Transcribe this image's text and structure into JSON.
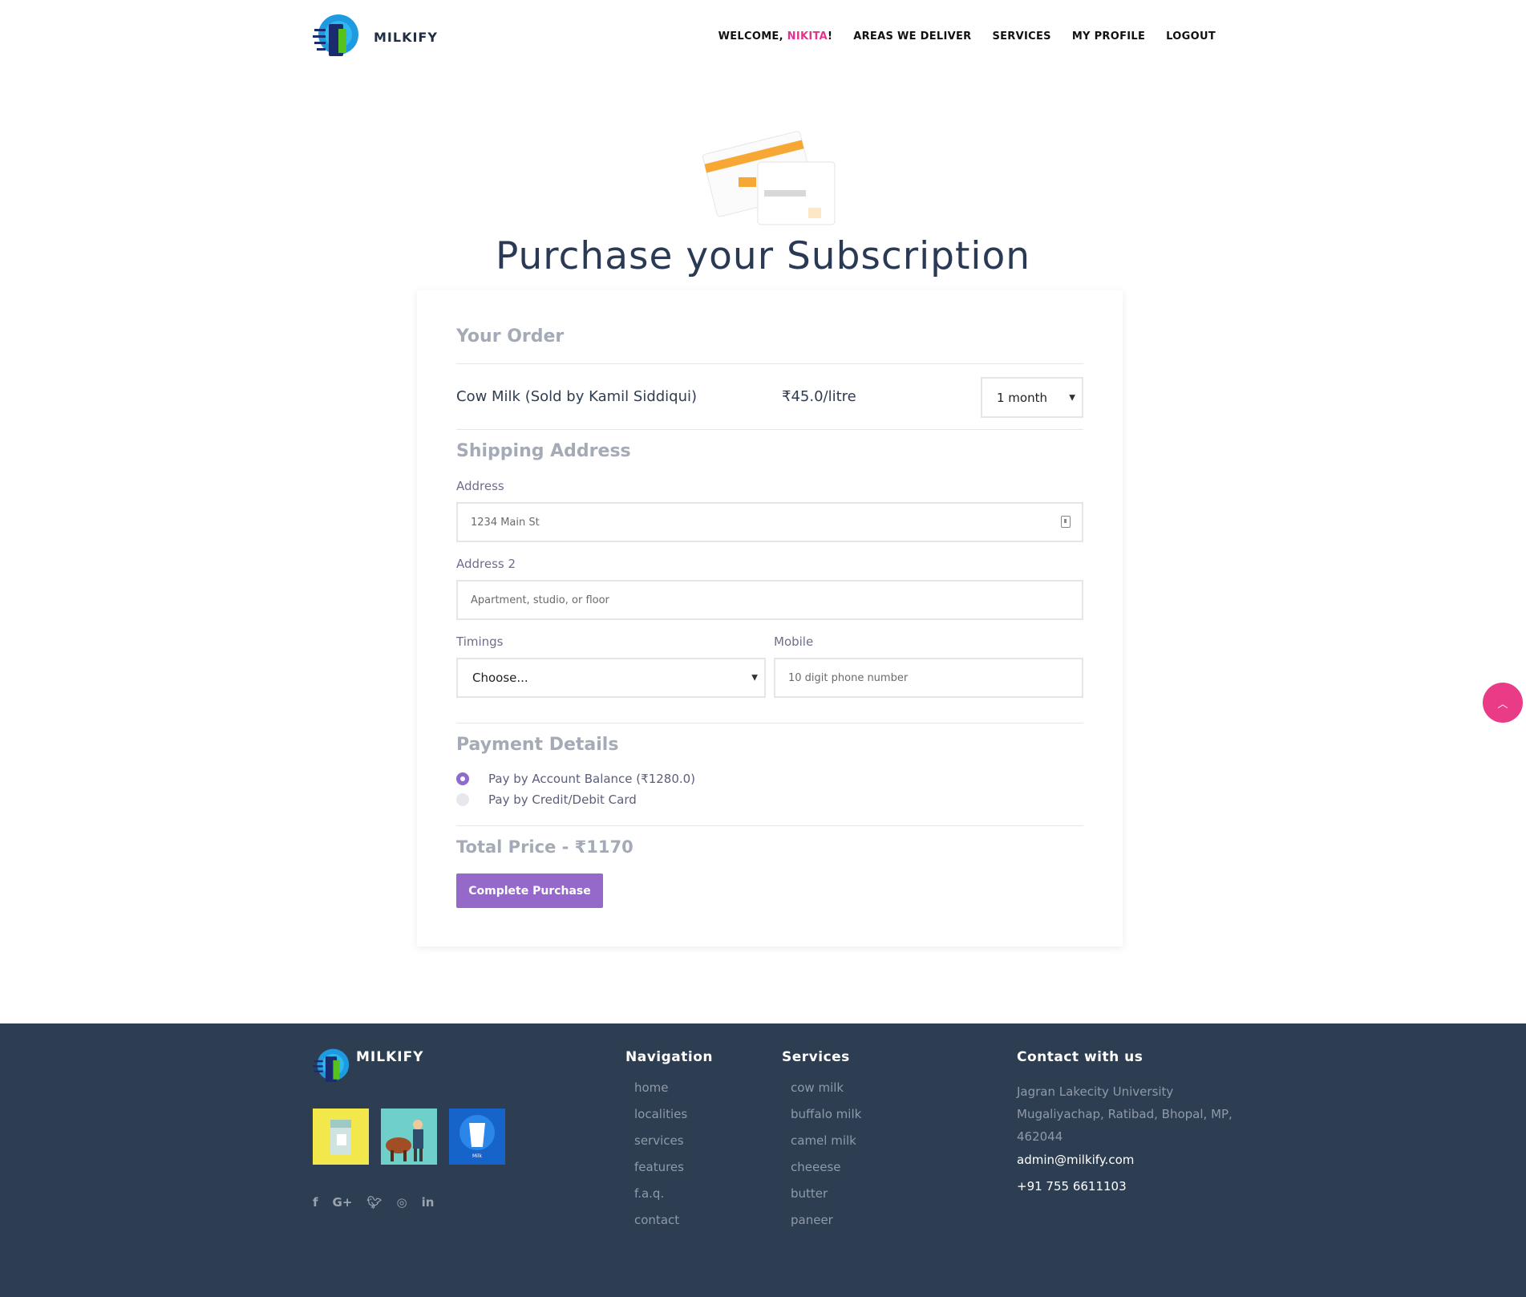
{
  "header": {
    "brand": "MILKIFY",
    "nav": {
      "welcome_prefix": "WELCOME, ",
      "user_name": "NIKITA",
      "welcome_suffix": "!",
      "areas": "AREAS WE DELIVER",
      "services": "SERVICES",
      "profile": "MY PROFILE",
      "logout": "LOGOUT"
    }
  },
  "hero": {
    "title": "Purchase your Subscription"
  },
  "order": {
    "section_title": "Your Order",
    "product": "Cow Milk (Sold by Kamil Siddiqui)",
    "price": "₹45.0/litre",
    "duration_selected": "1 month"
  },
  "shipping": {
    "section_title": "Shipping Address",
    "address_label": "Address",
    "address_placeholder": "1234 Main St",
    "address2_label": "Address 2",
    "address2_placeholder": "Apartment, studio, or floor",
    "timings_label": "Timings",
    "timings_selected": "Choose...",
    "mobile_label": "Mobile",
    "mobile_placeholder": "10 digit phone number"
  },
  "payment": {
    "section_title": "Payment Details",
    "options": [
      {
        "label": "Pay by Account Balance (₹1280.0)",
        "selected": true
      },
      {
        "label": "Pay by Credit/Debit Card",
        "selected": false
      }
    ],
    "total": "Total Price - ₹1170",
    "submit_label": "Complete Purchase"
  },
  "footer": {
    "brand": "MILKIFY",
    "thumb_caption": "Milk",
    "navigation": {
      "title": "Navigation",
      "items": [
        "home",
        "localities",
        "services",
        "features",
        "f.a.q.",
        "contact"
      ]
    },
    "services": {
      "title": "Services",
      "items": [
        "cow milk",
        "buffalo milk",
        "camel milk",
        "cheeese",
        "butter",
        "paneer"
      ]
    },
    "contact": {
      "title": "Contact with us",
      "address": "Jagran Lakecity University Mugaliyachap, Ratibad, Bhopal, MP, 462044",
      "email": "admin@milkify.com",
      "phone": "+91 755 6611103"
    },
    "social_icons": [
      "facebook-icon",
      "google-plus-icon",
      "twitter-icon",
      "instagram-icon",
      "linkedin-icon"
    ]
  },
  "colors": {
    "accent_pink": "#e8318f",
    "button_purple": "#9469c9",
    "footer_bg": "#2d3e53",
    "title_navy": "#2a3a55"
  }
}
